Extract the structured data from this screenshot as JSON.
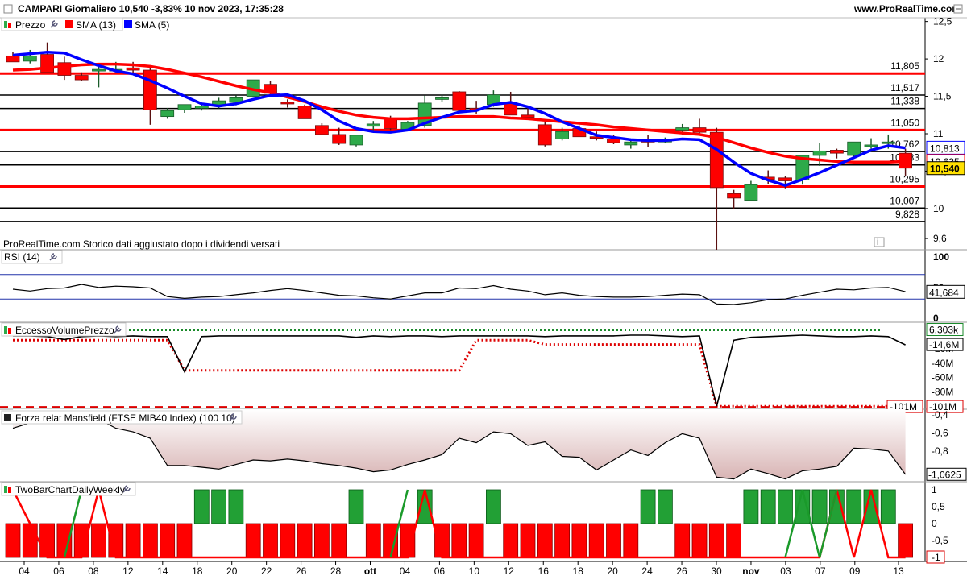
{
  "header": {
    "left": "CAMPARI Giornaliero 10,540 -3,83% 10 nov 2023, 17:35:28",
    "right": "www.ProRealTime.com"
  },
  "icons": [
    "settings-wrench-icon",
    "minimize-square-icon",
    "info-icon",
    "candlestick-legend-icon"
  ],
  "colors": {
    "up": "#2eaa4a",
    "down": "#ff0000",
    "sma13": "#ff0000",
    "sma5": "#0000ff",
    "grid": "#000000",
    "mansfield_fill": "#d8b4b4"
  },
  "chart_data": [
    {
      "type": "candlestick",
      "id": "price",
      "legend": [
        {
          "name": "Prezzo",
          "color": "#2eaa4a"
        },
        {
          "name": "SMA (13)",
          "color": "#ff0000"
        },
        {
          "name": "SMA (5)",
          "color": "#0000ff"
        }
      ],
      "note": "ProRealTime.com Storico dati aggiustato dopo i dividendi versati",
      "yticks": [
        "12,5",
        "12",
        "11,5",
        "11",
        "10,5",
        "10",
        "9,6"
      ],
      "ylim": [
        9.45,
        12.55
      ],
      "levels": [
        {
          "value": 11.805,
          "label": "11,805",
          "color": "#ff0000"
        },
        {
          "value": 11.517,
          "label": "11,517",
          "color": "#000000"
        },
        {
          "value": 11.338,
          "label": "11,338",
          "color": "#000000"
        },
        {
          "value": 11.05,
          "label": "11,050",
          "color": "#ff0000"
        },
        {
          "value": 10.762,
          "label": "10,762",
          "color": "#000000"
        },
        {
          "value": 10.583,
          "label": "10,583",
          "color": "#000000"
        },
        {
          "value": 10.295,
          "label": "10,295",
          "color": "#ff0000"
        },
        {
          "value": 10.007,
          "label": "10,007",
          "color": "#000000"
        },
        {
          "value": 9.828,
          "label": "9,828",
          "color": "#000000"
        }
      ],
      "tags": [
        {
          "value": 10.813,
          "label": "10,813",
          "color": "#0000ff"
        },
        {
          "value": 10.635,
          "label": "10,635",
          "color": "#ff0000"
        },
        {
          "value": 10.54,
          "label": "10,540",
          "color": "#000000",
          "bg": "#ffe000"
        }
      ],
      "candles": [
        [
          12.04,
          12.09,
          11.98,
          11.96
        ],
        [
          11.97,
          12.12,
          11.94,
          12.04
        ],
        [
          12.06,
          12.22,
          11.95,
          11.82
        ],
        [
          11.95,
          12.03,
          11.72,
          11.78
        ],
        [
          11.78,
          11.82,
          11.7,
          11.72
        ],
        [
          11.84,
          11.92,
          11.62,
          11.86
        ],
        [
          11.84,
          11.96,
          11.82,
          11.86
        ],
        [
          11.88,
          11.96,
          11.8,
          11.85
        ],
        [
          11.85,
          11.88,
          11.12,
          11.32
        ],
        [
          11.23,
          11.34,
          11.2,
          11.31
        ],
        [
          11.32,
          11.39,
          11.28,
          11.39
        ],
        [
          11.34,
          11.4,
          11.31,
          11.37
        ],
        [
          11.37,
          11.48,
          11.34,
          11.44
        ],
        [
          11.42,
          11.51,
          11.38,
          11.48
        ],
        [
          11.5,
          11.72,
          11.5,
          11.72
        ],
        [
          11.66,
          11.7,
          11.52,
          11.54
        ],
        [
          11.42,
          11.46,
          11.35,
          11.4
        ],
        [
          11.37,
          11.39,
          11.2,
          11.2
        ],
        [
          11.11,
          11.14,
          10.98,
          10.99
        ],
        [
          10.99,
          11.08,
          10.85,
          10.87
        ],
        [
          10.85,
          10.97,
          10.83,
          10.98
        ],
        [
          11.1,
          11.17,
          11.05,
          11.13
        ],
        [
          11.21,
          11.24,
          11.05,
          11.07
        ],
        [
          11.06,
          11.17,
          11.05,
          11.15
        ],
        [
          11.11,
          11.51,
          11.08,
          11.41
        ],
        [
          11.48,
          11.52,
          11.43,
          11.48
        ],
        [
          11.56,
          11.57,
          11.31,
          11.31
        ],
        [
          11.34,
          11.44,
          11.27,
          11.32
        ],
        [
          11.39,
          11.58,
          11.36,
          11.52
        ],
        [
          11.42,
          11.56,
          11.25,
          11.25
        ],
        [
          11.25,
          11.37,
          11.2,
          11.22
        ],
        [
          11.12,
          11.16,
          10.83,
          10.85
        ],
        [
          10.93,
          11.08,
          10.91,
          11.03
        ],
        [
          11.07,
          11.11,
          10.96,
          10.96
        ],
        [
          10.96,
          11.03,
          10.91,
          10.94
        ],
        [
          10.93,
          10.98,
          10.86,
          10.88
        ],
        [
          10.85,
          10.93,
          10.8,
          10.89
        ],
        [
          10.91,
          10.98,
          10.82,
          10.9
        ],
        [
          10.89,
          10.95,
          10.88,
          10.93
        ],
        [
          11.05,
          11.13,
          10.98,
          11.08
        ],
        [
          11.08,
          11.2,
          10.98,
          11.02
        ],
        [
          11.02,
          11.08,
          9.45,
          10.28
        ],
        [
          10.2,
          10.25,
          10.0,
          10.14
        ],
        [
          10.11,
          10.37,
          10.11,
          10.32
        ],
        [
          10.42,
          10.51,
          10.33,
          10.39
        ],
        [
          10.41,
          10.44,
          10.27,
          10.37
        ],
        [
          10.38,
          10.71,
          10.32,
          10.71
        ],
        [
          10.71,
          10.88,
          10.57,
          10.77
        ],
        [
          10.78,
          10.8,
          10.67,
          10.74
        ],
        [
          10.71,
          10.89,
          10.69,
          10.89
        ],
        [
          10.85,
          10.94,
          10.8,
          10.85
        ],
        [
          10.88,
          10.99,
          10.8,
          10.89
        ],
        [
          10.74,
          10.8,
          10.44,
          10.54
        ]
      ],
      "sma13": [
        11.85,
        11.86,
        11.88,
        11.9,
        11.92,
        11.93,
        11.93,
        11.92,
        11.9,
        11.86,
        11.81,
        11.76,
        11.7,
        11.64,
        11.59,
        11.55,
        11.49,
        11.43,
        11.36,
        11.3,
        11.25,
        11.22,
        11.2,
        11.2,
        11.21,
        11.22,
        11.23,
        11.23,
        11.23,
        11.21,
        11.2,
        11.18,
        11.16,
        11.14,
        11.12,
        11.09,
        11.07,
        11.05,
        11.03,
        11.01,
        10.99,
        10.95,
        10.88,
        10.81,
        10.75,
        10.7,
        10.67,
        10.65,
        10.63,
        10.62,
        10.62,
        10.62,
        10.63
      ],
      "sma5": [
        12.05,
        12.07,
        12.09,
        12.08,
        11.99,
        11.91,
        11.84,
        11.8,
        11.71,
        11.61,
        11.5,
        11.4,
        11.37,
        11.4,
        11.46,
        11.51,
        11.52,
        11.44,
        11.32,
        11.17,
        11.07,
        11.03,
        11.02,
        11.05,
        11.14,
        11.22,
        11.29,
        11.31,
        11.39,
        11.42,
        11.36,
        11.27,
        11.16,
        11.07,
        10.98,
        10.95,
        10.92,
        10.91,
        10.91,
        10.93,
        10.92,
        10.79,
        10.62,
        10.47,
        10.38,
        10.31,
        10.39,
        10.48,
        10.58,
        10.68,
        10.78,
        10.84,
        10.81
      ],
      "last_price": 10.54
    },
    {
      "type": "line",
      "id": "rsi",
      "title": "RSI (14)",
      "yticks": [
        "100",
        "50",
        "0"
      ],
      "ylim": [
        0,
        100
      ],
      "band": [
        30,
        70
      ],
      "last_label": "41,684",
      "values": [
        46,
        43,
        47,
        48,
        54,
        49,
        51,
        50,
        48,
        34,
        31,
        33,
        34,
        37,
        40,
        44,
        47,
        44,
        40,
        36,
        35,
        32,
        30,
        35,
        40,
        40,
        48,
        47,
        52,
        46,
        43,
        37,
        40,
        36,
        34,
        33,
        33,
        34,
        36,
        38,
        37,
        22,
        21,
        24,
        29,
        30,
        36,
        41,
        46,
        45,
        48,
        49,
        42
      ]
    },
    {
      "type": "line",
      "id": "volume_excess",
      "title": "EccessoVolumePrezzo",
      "yticks": [
        "-20M",
        "-40M",
        "-60M",
        "-80M"
      ],
      "ylim": [
        -102,
        8
      ],
      "labels": [
        "6,303k",
        "-14,6M",
        "-101M",
        "-101M"
      ],
      "black": [
        -2,
        -2,
        -3,
        -7,
        -3,
        -2,
        -3,
        -2,
        -3,
        -3,
        -52,
        -3,
        -2,
        -2,
        -2,
        -2,
        -2,
        -2,
        -2,
        -2,
        -4,
        -2,
        -3,
        -2,
        -2,
        -3,
        -2,
        -2,
        -2,
        -2,
        -2,
        -3,
        -2,
        -2,
        -2,
        -2,
        -1,
        -1,
        -2,
        -3,
        -2,
        -100,
        -8,
        -4,
        -3,
        -2,
        -1,
        -2,
        -3,
        -3,
        -2,
        -3,
        -14.6
      ],
      "dotted_red": [
        -8,
        -8,
        -8,
        -8,
        -8,
        -8,
        -8,
        -8,
        -8,
        -8,
        -50,
        -50,
        -50,
        -50,
        -50,
        -50,
        -50,
        -50,
        -50,
        -50,
        -50,
        -50,
        -50,
        -50,
        -50,
        -50,
        -50,
        -8,
        -8,
        -8,
        -8,
        -14,
        -14,
        -14,
        -14,
        -14,
        -14,
        -14,
        -14,
        -14,
        -14,
        -100,
        -100,
        -100,
        -100,
        -100,
        -100,
        -100,
        -100,
        -100,
        -100,
        -100,
        -100
      ],
      "dotted_green": 6.3,
      "dashed_red": -101
    },
    {
      "type": "area",
      "id": "mansfield",
      "title": "Forza relat Mansfield (FTSE MIB40 Index) (100 10)",
      "yticks": [
        "-0,4",
        "-0,6",
        "-0,8"
      ],
      "ylim": [
        -1.14,
        -0.34
      ],
      "last_label": "-1,0625",
      "values": [
        -0.55,
        -0.49,
        -0.43,
        -0.39,
        -0.43,
        -0.45,
        -0.55,
        -0.59,
        -0.66,
        -0.96,
        -0.96,
        -0.98,
        -1.0,
        -0.95,
        -0.9,
        -0.91,
        -0.89,
        -0.91,
        -0.94,
        -0.96,
        -0.99,
        -1.03,
        -1.01,
        -0.95,
        -0.9,
        -0.84,
        -0.66,
        -0.71,
        -0.59,
        -0.61,
        -0.74,
        -0.7,
        -0.86,
        -0.87,
        -1.01,
        -0.9,
        -0.79,
        -0.85,
        -0.71,
        -0.61,
        -0.66,
        -1.09,
        -1.11,
        -1.0,
        -1.05,
        -1.11,
        -1.02,
        -1.0,
        -0.97,
        -0.77,
        -0.78,
        -0.8,
        -1.06
      ]
    },
    {
      "type": "bar",
      "id": "twobar",
      "title": "TwoBarChartDailyWeekly",
      "yticks": [
        "1",
        "0,5",
        "0",
        "-0,5"
      ],
      "ylim": [
        -1.15,
        1.15
      ],
      "last_label": "-1",
      "bars": [
        -1,
        -1,
        -1,
        -1,
        -1,
        -1,
        -1,
        -1,
        -1,
        -1,
        -1,
        1,
        1,
        1,
        -1,
        -1,
        -1,
        -1,
        -1,
        -1,
        1,
        -1,
        -1,
        -1,
        1,
        -1,
        -1,
        -1,
        1,
        -1,
        -1,
        -1,
        -1,
        -1,
        -1,
        -1,
        -1,
        1,
        1,
        -1,
        -1,
        -1,
        -1,
        1,
        1,
        1,
        1,
        1,
        1,
        1,
        1,
        1,
        -1
      ],
      "red_line": [
        1,
        0,
        -1,
        -1,
        -1,
        1,
        -1,
        -1,
        -1,
        -1,
        -1,
        -1,
        -1,
        -1,
        -1,
        -1,
        -1,
        -1,
        -1,
        -1,
        -1,
        -1,
        -1,
        -1,
        1,
        -1,
        -1,
        -1,
        -1,
        -1,
        -1,
        -1,
        -1,
        -1,
        -1,
        -1,
        -1,
        -1,
        -1,
        -1,
        -1,
        -1,
        -1,
        -1,
        -1,
        -1,
        -1,
        -1,
        1,
        -1,
        1,
        -1,
        -1
      ],
      "green_line": [
        null,
        null,
        null,
        -1,
        1,
        null,
        null,
        null,
        null,
        null,
        null,
        null,
        null,
        null,
        null,
        null,
        null,
        null,
        null,
        null,
        null,
        null,
        -1,
        1,
        null,
        null,
        null,
        null,
        null,
        null,
        null,
        null,
        null,
        null,
        null,
        null,
        null,
        null,
        null,
        null,
        null,
        null,
        null,
        null,
        null,
        -1,
        1,
        -1,
        1,
        null,
        null,
        null,
        null
      ]
    }
  ],
  "x_axis": {
    "labels": [
      "04",
      "06",
      "08",
      "12",
      "14",
      "18",
      "20",
      "22",
      "26",
      "28",
      "ott",
      "04",
      "06",
      "10",
      "12",
      "16",
      "18",
      "20",
      "24",
      "26",
      "30",
      "nov",
      "03",
      "07",
      "09",
      "13"
    ],
    "months_bold": [
      "ott",
      "nov"
    ]
  }
}
